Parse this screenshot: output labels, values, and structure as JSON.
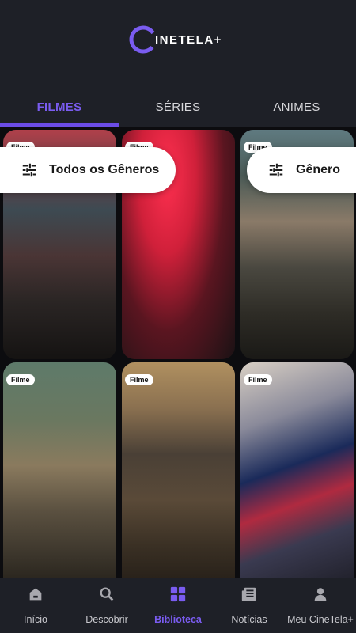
{
  "app": {
    "logo_text": "INETELA+",
    "logo_letter": "C"
  },
  "tabs": [
    {
      "label": "FILMES",
      "active": true
    },
    {
      "label": "SÉRIES",
      "active": false
    },
    {
      "label": "ANIMES",
      "active": false
    }
  ],
  "cards": [
    {
      "badge": "Filme"
    },
    {
      "badge": "Filme"
    },
    {
      "badge": "Filme"
    },
    {
      "badge": "Filme"
    },
    {
      "badge": "Filme"
    },
    {
      "badge": "Filme"
    }
  ],
  "filters": {
    "all_genres": "Todos os Gêneros",
    "genre": "Gênero",
    "icon": "sliders-icon"
  },
  "nav": [
    {
      "label": "Início",
      "icon": "home-icon",
      "active": false
    },
    {
      "label": "Descobrir",
      "icon": "search-icon",
      "active": false
    },
    {
      "label": "Biblioteca",
      "icon": "grid-icon",
      "active": true
    },
    {
      "label": "Notícias",
      "icon": "news-icon",
      "active": false
    },
    {
      "label": "Meu CineTela+",
      "icon": "profile-icon",
      "active": false
    }
  ],
  "colors": {
    "accent": "#6b4ce6",
    "bar": "#1e2027",
    "background": "#0c0c0f"
  }
}
